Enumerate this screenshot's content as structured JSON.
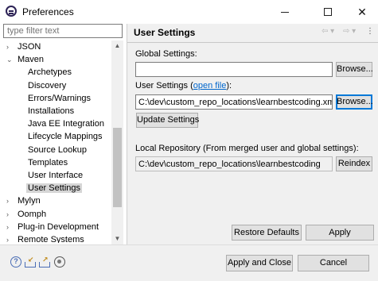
{
  "window": {
    "title": "Preferences",
    "minimize_glyph": "",
    "maximize_glyph": "",
    "close_glyph": "✕"
  },
  "sidebar": {
    "filter_placeholder": "type filter text",
    "items": [
      {
        "label": "JSON",
        "level": 0,
        "arrow": "›",
        "selected": false
      },
      {
        "label": "Maven",
        "level": 0,
        "arrow": "⌄",
        "selected": false
      },
      {
        "label": "Archetypes",
        "level": 1,
        "arrow": "",
        "selected": false
      },
      {
        "label": "Discovery",
        "level": 1,
        "arrow": "",
        "selected": false
      },
      {
        "label": "Errors/Warnings",
        "level": 1,
        "arrow": "",
        "selected": false
      },
      {
        "label": "Installations",
        "level": 1,
        "arrow": "",
        "selected": false
      },
      {
        "label": "Java EE Integration",
        "level": 1,
        "arrow": "",
        "selected": false
      },
      {
        "label": "Lifecycle Mappings",
        "level": 1,
        "arrow": "",
        "selected": false
      },
      {
        "label": "Source Lookup",
        "level": 1,
        "arrow": "",
        "selected": false
      },
      {
        "label": "Templates",
        "level": 1,
        "arrow": "",
        "selected": false
      },
      {
        "label": "User Interface",
        "level": 1,
        "arrow": "",
        "selected": false
      },
      {
        "label": "User Settings",
        "level": 1,
        "arrow": "",
        "selected": true
      },
      {
        "label": "Mylyn",
        "level": 0,
        "arrow": "›",
        "selected": false
      },
      {
        "label": "Oomph",
        "level": 0,
        "arrow": "›",
        "selected": false
      },
      {
        "label": "Plug-in Development",
        "level": 0,
        "arrow": "›",
        "selected": false
      },
      {
        "label": "Remote Systems",
        "level": 0,
        "arrow": "›",
        "selected": false
      }
    ],
    "scroll_up": "▲",
    "scroll_down": "▼"
  },
  "page": {
    "title": "User Settings",
    "nav_back": "⇦ ▾",
    "nav_forward": "⇨ ▾",
    "nav_menu": "⋮"
  },
  "global_settings": {
    "label": "Global Settings:",
    "value": "",
    "browse_label": "Browse..."
  },
  "user_settings": {
    "label_prefix": "User Settings (",
    "link_text": "open file",
    "label_suffix": "):",
    "value": "C:\\dev\\custom_repo_locations\\learnbestcoding.xml",
    "browse_label": "Browse...",
    "update_label": "Update Settings"
  },
  "local_repository": {
    "label": "Local Repository (From merged user and global settings):",
    "value": "C:\\dev\\custom_repo_locations\\learnbestcoding",
    "reindex_label": "Reindex"
  },
  "page_buttons": {
    "restore_defaults": "Restore Defaults",
    "apply": "Apply"
  },
  "footer": {
    "help_glyph": "?",
    "apply_and_close": "Apply and Close",
    "cancel": "Cancel"
  }
}
